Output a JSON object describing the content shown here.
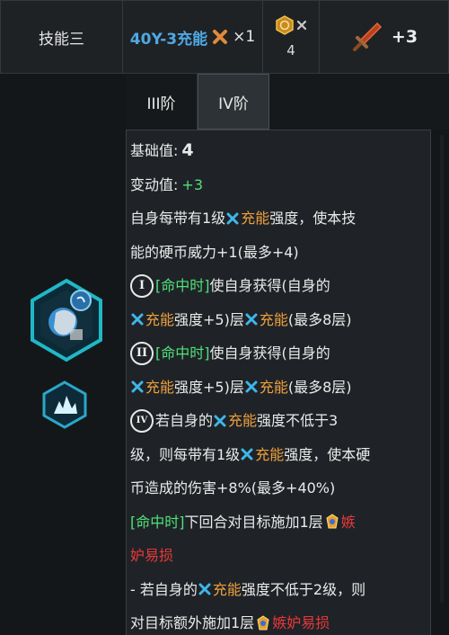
{
  "header": {
    "skill_name": "技能三",
    "charge_label": "40Y-3充能",
    "charge_mult": "×1",
    "coin_count": "4",
    "attack_bonus": "+3"
  },
  "tabs": [
    {
      "label": "III阶",
      "active": false
    },
    {
      "label": "IV阶",
      "active": true
    }
  ],
  "desc": {
    "base_label": "基础值:",
    "base_value": "4",
    "var_label": "变动值:",
    "var_value": "+3",
    "p1a": "自身每带有1级",
    "kw_charge": "充能",
    "p1b": "强度，使本技",
    "p1c": "能的硬币威力+1(最多+4)",
    "roman_1": "I",
    "roman_2": "II",
    "roman_4": "IV",
    "on_hit": "[命中时]",
    "gain_a": "使自身获得(自身的",
    "gain_b": "强度+5)层",
    "gain_c": "(最多8层)",
    "p4a": "若自身的",
    "p4b": "强度不低于3",
    "p4c": "级，则每带有1级",
    "p4d": "强度，使本硬",
    "p4e": "币造成的伤害+8%(最多+40%)",
    "p5a": "下回合对目标施加1层",
    "envy1": "嫉",
    "envy2": "妒易损",
    "p6a": "- 若自身的",
    "p6b": "强度不低于2级，则",
    "p6c": "对目标额外施加1层",
    "envy_full": "嫉妒易损"
  },
  "colors": {
    "charge_blue": "#4fa8e4",
    "keyword_green": "#4fe07a",
    "keyword_orange": "#f0a03c",
    "envy_red": "#e8383a"
  },
  "icons": [
    "x-cross-icon",
    "coin-icon",
    "sword-icon",
    "charge-icon",
    "envy-icon",
    "skill-emblem-icon",
    "passive-emblem-icon"
  ]
}
